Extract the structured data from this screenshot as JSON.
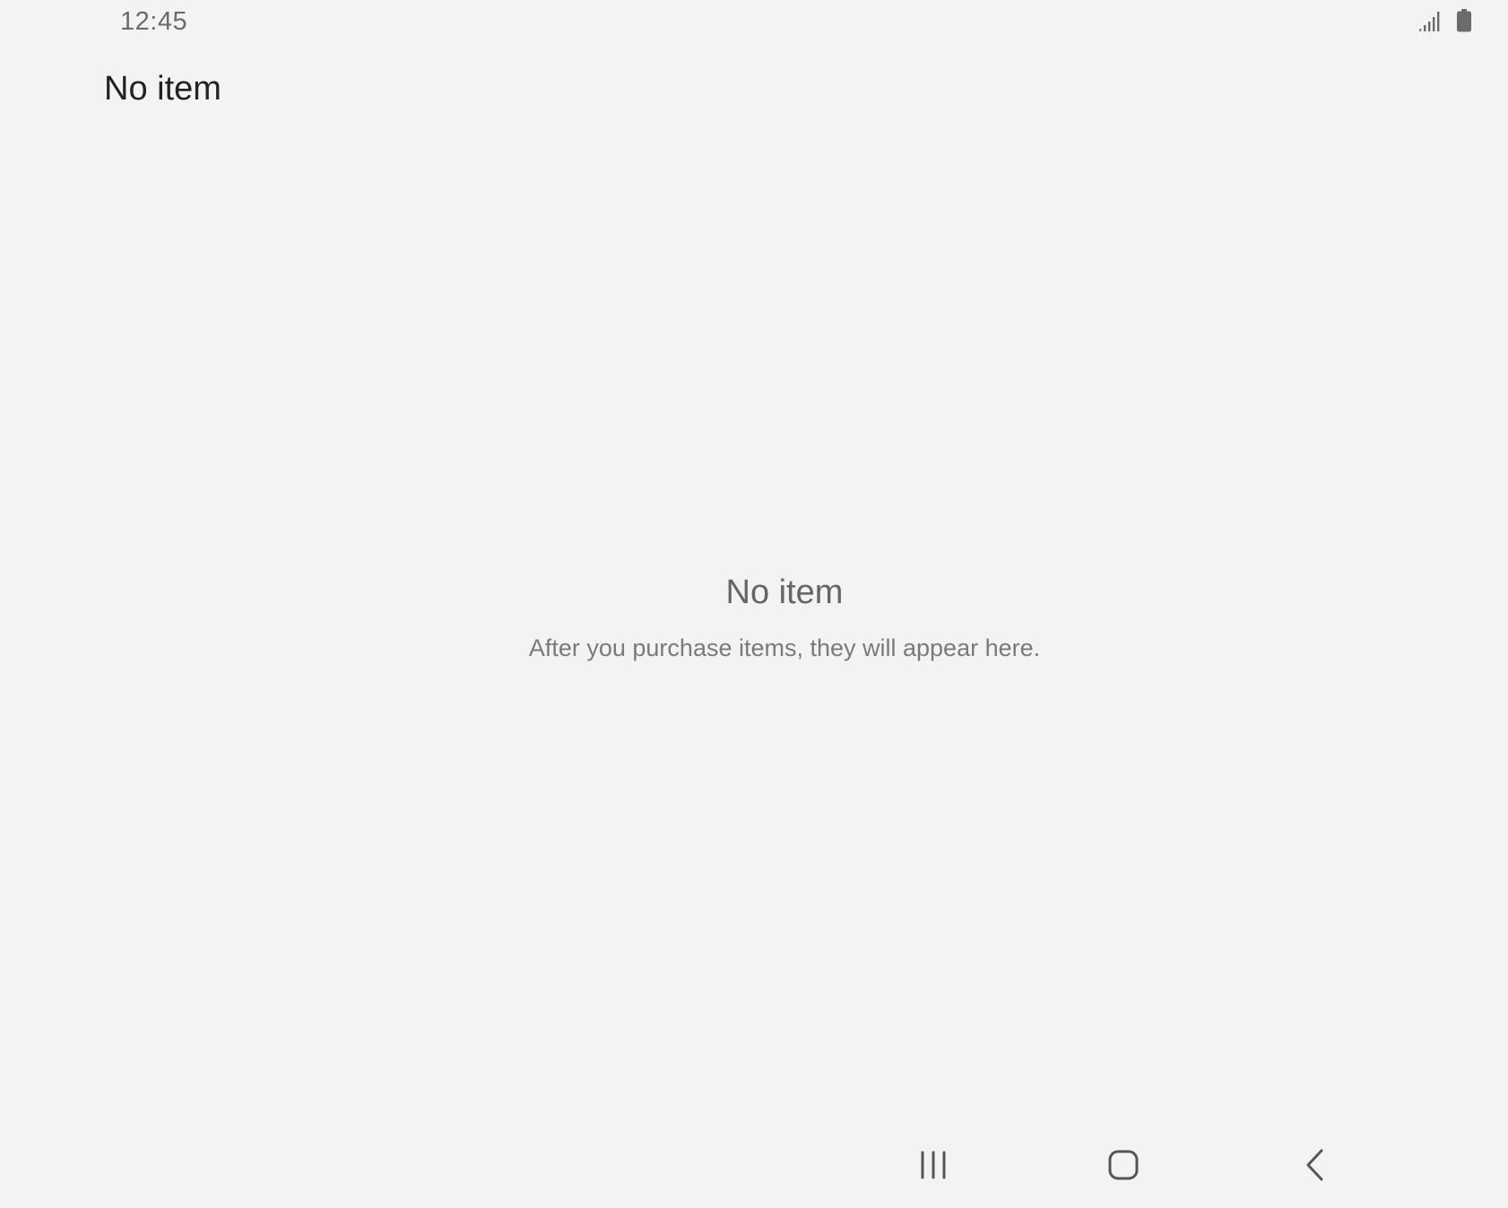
{
  "status_bar": {
    "time": "12:45",
    "icons": [
      "signal-icon",
      "battery-icon"
    ]
  },
  "app_bar": {
    "title": "No item"
  },
  "empty_state": {
    "title": "No item",
    "description": "After you purchase items, they will appear here."
  },
  "nav_bar": {
    "buttons": [
      "recents-icon",
      "home-icon",
      "back-icon"
    ]
  },
  "colors": {
    "background": "#f3f3f3",
    "title_text": "#222222",
    "secondary_text": "#6b6b6b"
  }
}
